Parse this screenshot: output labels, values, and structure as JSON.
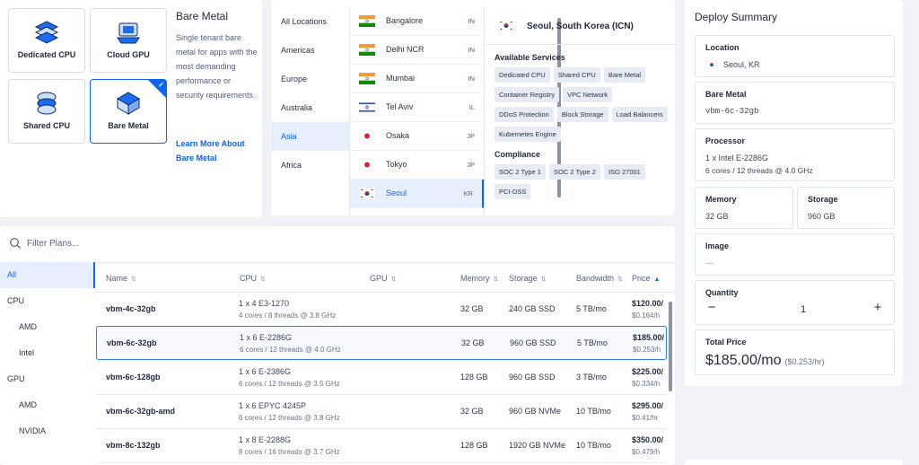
{
  "server_types": {
    "items": [
      {
        "label": "Dedicated CPU",
        "icon": "dedicated-cpu-icon"
      },
      {
        "label": "Cloud GPU",
        "icon": "cloud-gpu-icon"
      },
      {
        "label": "Shared CPU",
        "icon": "shared-cpu-icon"
      },
      {
        "label": "Bare Metal",
        "icon": "bare-metal-icon",
        "selected": true
      }
    ],
    "description": {
      "title": "Bare Metal",
      "text": "Single tenant bare metal for apps with the most demanding performance or security requirements.",
      "link": "Learn More About Bare Metal"
    }
  },
  "locations": {
    "regions": [
      "All Locations",
      "Americas",
      "Europe",
      "Australia",
      "Asia",
      "Africa"
    ],
    "active_region": "Asia",
    "cities": [
      {
        "name": "Bangalore",
        "code": "IN",
        "flag": "india-flag"
      },
      {
        "name": "Delhi NCR",
        "code": "IN",
        "flag": "india-flag"
      },
      {
        "name": "Mumbai",
        "code": "IN",
        "flag": "india-flag"
      },
      {
        "name": "Tel Aviv",
        "code": "IL",
        "flag": "israel-flag"
      },
      {
        "name": "Osaka",
        "code": "JP",
        "flag": "japan-flag"
      },
      {
        "name": "Tokyo",
        "code": "JP",
        "flag": "japan-flag"
      },
      {
        "name": "Seoul",
        "code": "KR",
        "flag": "south-korea-flag",
        "selected": true
      }
    ],
    "detail": {
      "title": "Seoul, South Korea (ICN)",
      "services_label": "Available Services",
      "services": [
        "Dedicated CPU",
        "Shared CPU",
        "Bare Metal",
        "Container Registry",
        "VPC Network",
        "DDoS Protection",
        "Block Storage",
        "Load Balancers",
        "Kubernetes Engine"
      ],
      "compliance_label": "Compliance",
      "compliance": [
        "SOC 2 Type 1",
        "SOC 2 Type 2",
        "ISO 27001",
        "PCI-DSS"
      ]
    }
  },
  "plans": {
    "filter_placeholder": "Filter Plans...",
    "categories": [
      {
        "label": "All",
        "level": 0,
        "active": true
      },
      {
        "label": "CPU",
        "level": 0
      },
      {
        "label": "AMD",
        "level": 1
      },
      {
        "label": "Intel",
        "level": 1
      },
      {
        "label": "GPU",
        "level": 0
      },
      {
        "label": "AMD",
        "level": 1
      },
      {
        "label": "NVIDIA",
        "level": 1
      }
    ],
    "columns": [
      "Name",
      "CPU",
      "GPU",
      "Memory",
      "Storage",
      "Bandwidth",
      "Price"
    ],
    "rows": [
      {
        "name": "vbm-4c-32gb",
        "cpu": "1 x 4 E3-1270",
        "cpu_detail": "4 cores / 8 threads @ 3.8 GHz",
        "memory": "32 GB",
        "storage": "240 GB SSD",
        "bandwidth": "5 TB/mo",
        "price": "$120.00/",
        "price_hr": "$0.164/h"
      },
      {
        "name": "vbm-6c-32gb",
        "cpu": "1 x 6 E-2286G",
        "cpu_detail": "6 cores / 12 threads @ 4.0 GHz",
        "memory": "32 GB",
        "storage": "960 GB SSD",
        "bandwidth": "5 TB/mo",
        "price": "$185.00/",
        "price_hr": "$0.253/h",
        "selected": true
      },
      {
        "name": "vbm-6c-128gb",
        "cpu": "1 x 6 E-2386G",
        "cpu_detail": "6 cores / 12 threads @ 3.5 GHz",
        "memory": "128 GB",
        "storage": "960 GB SSD",
        "bandwidth": "3 TB/mo",
        "price": "$225.00/",
        "price_hr": "$0.334/h"
      },
      {
        "name": "vbm-6c-32gb-amd",
        "cpu": "1 x 6 EPYC 4245P",
        "cpu_detail": "6 cores / 12 threads @ 3.8 GHz",
        "memory": "32 GB",
        "storage": "960 GB NVMe",
        "bandwidth": "10 TB/mo",
        "price": "$295.00/",
        "price_hr": "$0.41/hr"
      },
      {
        "name": "vbm-8c-132gb",
        "cpu": "1 x 8 E-2288G",
        "cpu_detail": "8 cores / 16 threads @ 3.7 GHz",
        "memory": "128 GB",
        "storage": "1920 GB NVMe",
        "bandwidth": "10 TB/mo",
        "price": "$350.00/",
        "price_hr": "$0.479/h"
      }
    ]
  },
  "summary": {
    "title": "Deploy Summary",
    "location_label": "Location",
    "location_value": "Seoul, KR",
    "plan_label": "Bare Metal",
    "plan_value": "vbm-6c-32gb",
    "processor_label": "Processor",
    "processor_value": "1 x Intel E-2286G",
    "processor_detail": "6 cores / 12 threads @ 4.0 GHz",
    "memory_label": "Memory",
    "memory_value": "32 GB",
    "storage_label": "Storage",
    "storage_value": "960 GB",
    "image_label": "Image",
    "image_value": "---",
    "quantity_label": "Quantity",
    "quantity_value": "1",
    "total_label": "Total Price",
    "total_value": "$185.00/mo",
    "total_hourly": "($0.253/hr)"
  },
  "colors": {
    "accent": "#0f63f5",
    "selected_bg": "#e7effe",
    "background": "#f1f2f6"
  }
}
